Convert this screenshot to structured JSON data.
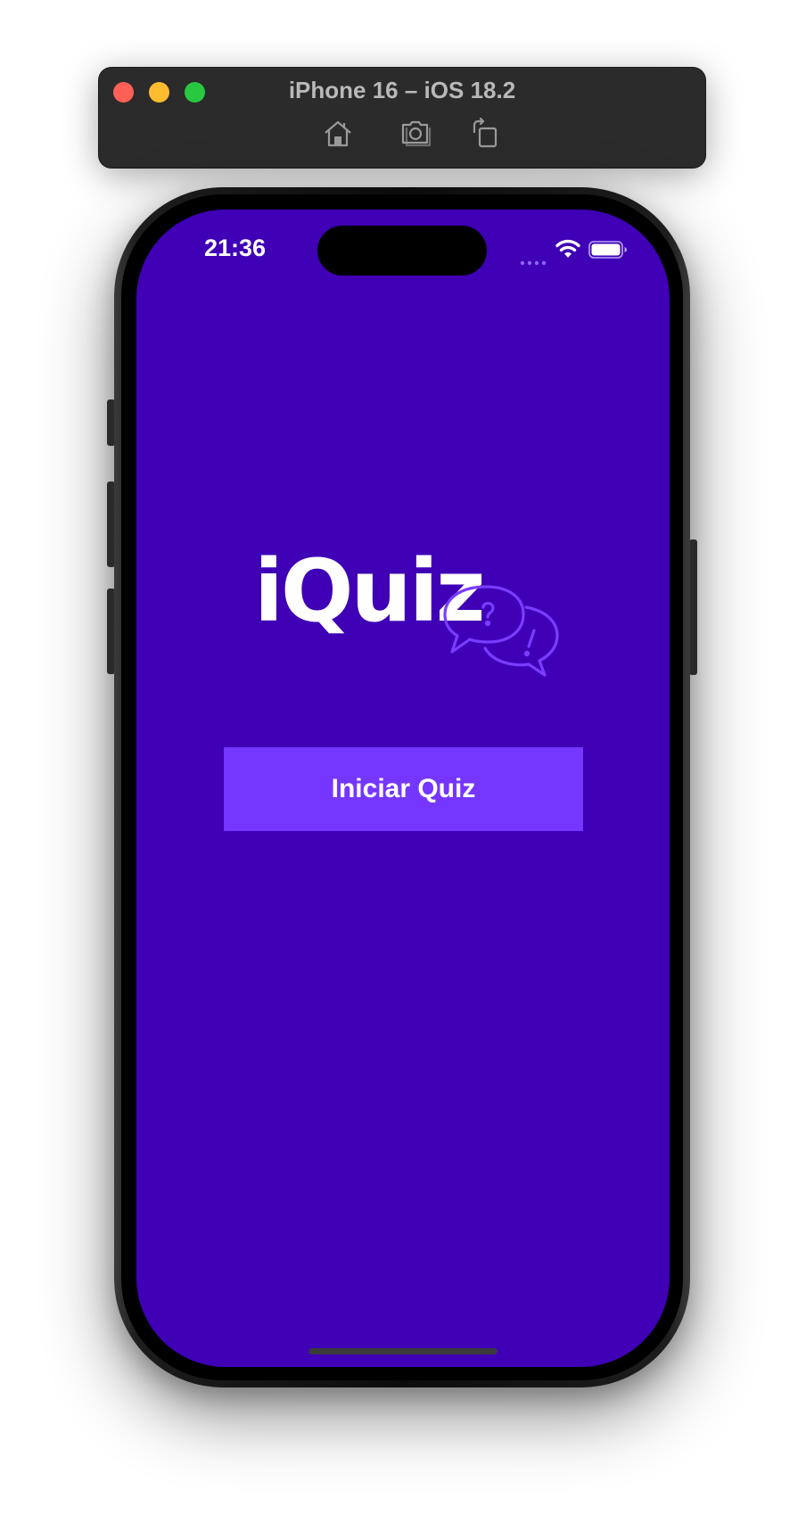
{
  "simulator": {
    "title": "iPhone 16 – iOS 18.2",
    "toolbar_icons": [
      "home-icon",
      "screenshot-icon",
      "rotate-icon"
    ]
  },
  "status_bar": {
    "time": "21:36",
    "icons": [
      "cellular-signal-icon",
      "wifi-icon",
      "battery-icon"
    ]
  },
  "app": {
    "logo_text": "iQuiz",
    "logo_icon": "speech-bubbles-question-exclamation-icon",
    "start_button_label": "Iniciar Quiz"
  },
  "colors": {
    "background": "#3f00b6",
    "button": "#7536ff",
    "accent_bubbles": "#7a3cff"
  }
}
